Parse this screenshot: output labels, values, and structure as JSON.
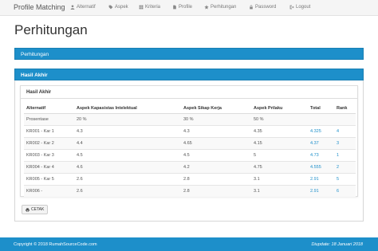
{
  "navbar": {
    "brand": "Profile Matching",
    "items": [
      {
        "label": "Alternatif",
        "icon": "user-icon"
      },
      {
        "label": "Aspek",
        "icon": "tag-icon"
      },
      {
        "label": "Kriteria",
        "icon": "grid-icon"
      },
      {
        "label": "Profile",
        "icon": "file-icon"
      },
      {
        "label": "Perhitungan",
        "icon": "star-icon"
      },
      {
        "label": "Password",
        "icon": "lock-icon"
      },
      {
        "label": "Logout",
        "icon": "logout-icon"
      }
    ]
  },
  "page": {
    "title": "Perhitungan",
    "section_bar": "Perhitungan",
    "panel_title": "Hasil Akhir"
  },
  "card": {
    "title": "Hasil Akhir",
    "columns": [
      "Alternatif",
      "Aspek Kapasistas Intelektual",
      "Aspek Sikap Kerja",
      "Aspek Prilaku",
      "Total",
      "Rank"
    ],
    "rows": [
      [
        "Prosentase",
        "20 %",
        "30 %",
        "50 %",
        "",
        ""
      ],
      [
        "KR001 - Kar 1",
        "4.3",
        "4.3",
        "4.35",
        "4.325",
        "4"
      ],
      [
        "KR002 - Kar 2",
        "4.4",
        "4.65",
        "4.15",
        "4.37",
        "3"
      ],
      [
        "KR003 - Kar 3",
        "4.5",
        "4.5",
        "5",
        "4.73",
        "1"
      ],
      [
        "KR004 - Kar 4",
        "4.6",
        "4.2",
        "4.75",
        "4.555",
        "2"
      ],
      [
        "KR005 - Kar 5",
        "2.6",
        "2.8",
        "3.1",
        "2.91",
        "5"
      ],
      [
        "KR006 -",
        "2.6",
        "2.8",
        "3.1",
        "2.91",
        "6"
      ]
    ],
    "print_label": "CETAK"
  },
  "footer": {
    "copyright": "Copyright © 2018 RumahSourceCode.com",
    "updated": "Diupdate: 18 Januari 2018"
  },
  "colors": {
    "primary": "#1d8fca",
    "navbar_bg": "#f5f5f5"
  }
}
